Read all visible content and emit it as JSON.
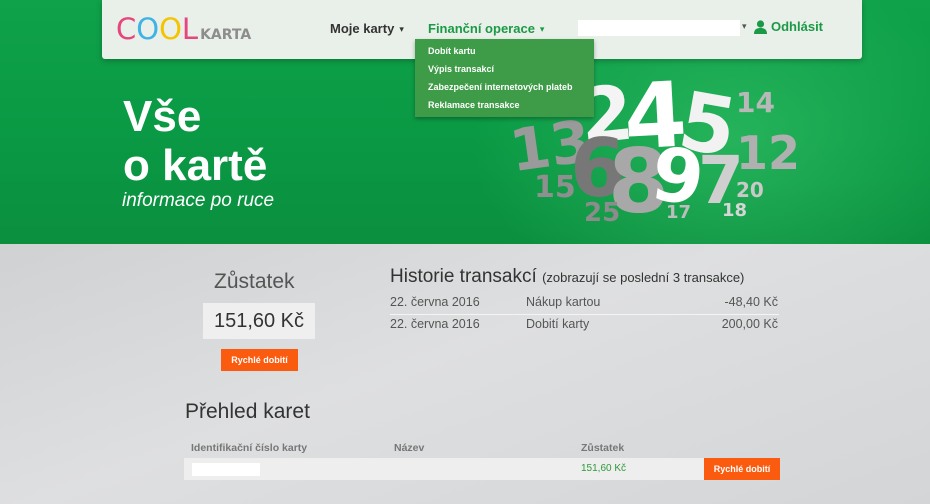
{
  "logo": {
    "letters": [
      {
        "char": "C",
        "color": "#e6457e"
      },
      {
        "char": "O",
        "color": "#3fb3e6"
      },
      {
        "char": "O",
        "color": "#f5c400"
      },
      {
        "char": "L",
        "color": "#e6457e"
      }
    ],
    "suffix": "KARTA"
  },
  "nav": {
    "my_cards": "Moje karty",
    "financial_ops": "Finanční operace",
    "caret": "▾",
    "logout": "Odhlásit"
  },
  "dropdown": {
    "items": [
      "Dobít kartu",
      "Výpis transakcí",
      "Zabezpečení internetových plateb",
      "Reklamace transakce"
    ]
  },
  "hero": {
    "title_line1": "Vše",
    "title_line2": "o kartě",
    "subtitle": "informace po ruce",
    "numbers": [
      "13",
      "2",
      "4",
      "5",
      "14",
      "12",
      "15",
      "6",
      "8",
      "9",
      "7",
      "20",
      "25",
      "17",
      "18"
    ]
  },
  "balance": {
    "title": "Zůstatek",
    "amount": "151,60 Kč",
    "quick_topup": "Rychlé dobití"
  },
  "history": {
    "title": "Historie transakcí",
    "note": "(zobrazují se poslední 3 transakce)",
    "rows": [
      {
        "date": "22. června 2016",
        "desc": "Nákup kartou",
        "amount": "-48,40 Kč"
      },
      {
        "date": "22. června 2016",
        "desc": "Dobití karty",
        "amount": "200,00 Kč"
      }
    ]
  },
  "cards": {
    "title": "Přehled karet",
    "headers": {
      "id": "Identifikační číslo karty",
      "name": "Název",
      "balance": "Zůstatek"
    },
    "rows": [
      {
        "balance": "151,60 Kč",
        "action": "Rychlé dobití"
      }
    ]
  },
  "colors": {
    "brand_green": "#1a9a46",
    "hero_green": "#0fa24a",
    "dropdown_green": "#3e9b47",
    "action_orange": "#fa5b0f"
  }
}
